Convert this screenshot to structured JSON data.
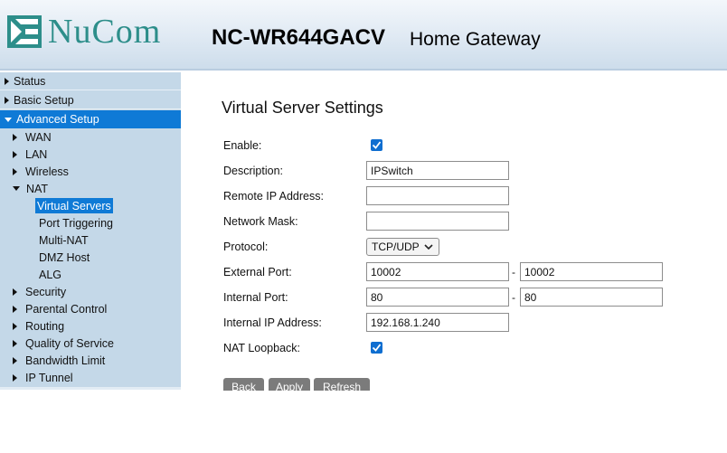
{
  "header": {
    "brand": "NuCom",
    "model": "NC-WR644GACV",
    "subtitle": "Home Gateway"
  },
  "sidebar": {
    "top_items": [
      {
        "label": "Status",
        "expanded": false
      },
      {
        "label": "Basic Setup",
        "expanded": false
      },
      {
        "label": "Advanced Setup",
        "expanded": true
      }
    ],
    "sub_items": [
      {
        "label": "WAN"
      },
      {
        "label": "LAN"
      },
      {
        "label": "Wireless"
      },
      {
        "label": "NAT"
      },
      {
        "label": "Security"
      },
      {
        "label": "Parental Control"
      },
      {
        "label": "Routing"
      },
      {
        "label": "Quality of Service"
      },
      {
        "label": "Bandwidth Limit"
      },
      {
        "label": "IP Tunnel"
      }
    ],
    "nat_items": [
      {
        "label": "Virtual Servers",
        "selected": true
      },
      {
        "label": "Port Triggering"
      },
      {
        "label": "Multi-NAT"
      },
      {
        "label": "DMZ Host"
      },
      {
        "label": "ALG"
      }
    ]
  },
  "form": {
    "title": "Virtual Server Settings",
    "labels": {
      "enable": "Enable:",
      "description": "Description:",
      "remote_ip": "Remote IP Address:",
      "network_mask": "Network Mask:",
      "protocol": "Protocol:",
      "external_port": "External Port:",
      "internal_port": "Internal Port:",
      "internal_ip": "Internal IP Address:",
      "nat_loopback": "NAT Loopback:"
    },
    "values": {
      "enable": true,
      "description": "IPSwitch",
      "remote_ip": "",
      "network_mask": "",
      "protocol": "TCP/UDP",
      "external_port_start": "10002",
      "external_port_end": "10002",
      "internal_port_start": "80",
      "internal_port_end": "80",
      "internal_ip": "192.168.1.240",
      "nat_loopback": true
    },
    "range_separator": "-"
  },
  "buttons": {
    "back": "Back",
    "apply": "Apply",
    "refresh": "Refresh"
  },
  "colors": {
    "accent": "#0f7ad6",
    "sidebar_bg": "#c4d8e8",
    "brand": "#2d8e8a",
    "button_bg": "#7b7b7b"
  }
}
